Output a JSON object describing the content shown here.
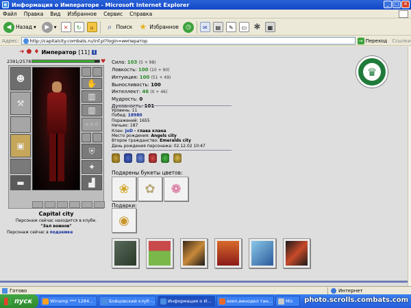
{
  "window": {
    "title": "Информация о Императоре - Microsoft Internet Explorer",
    "controls": [
      "_",
      "□",
      "✕"
    ]
  },
  "menu": [
    "Файл",
    "Правка",
    "Вид",
    "Избранное",
    "Сервис",
    "Справка"
  ],
  "toolbar": {
    "back": "Назад",
    "search": "Поиск",
    "favorites": "Избранное"
  },
  "address": {
    "label": "Адрес:",
    "url": "http://capitalcity.combats.ru/inf.pl?login=император",
    "go": "Переход",
    "links": "Ссылки"
  },
  "character": {
    "name": "Император",
    "level": "[11]",
    "hp": "2391/2578",
    "hp_fraction": 0.927,
    "city": "Capital city",
    "location_line1": "Персонаж сейчас находится в клубе.",
    "location_line2": "\"Зал воинов\"",
    "online_prefix": "Персонаж сейчас в",
    "online_link": "подземке"
  },
  "stats": [
    {
      "label": "Сила:",
      "value": "103",
      "bonus": "(5 + 98)",
      "green": true
    },
    {
      "label": "Ловкость:",
      "value": "100",
      "bonus": "(10 + 90)",
      "green": true
    },
    {
      "label": "Интуиция:",
      "value": "100",
      "bonus": "(51 + 49)",
      "green": true
    },
    {
      "label": "Выносливость:",
      "value": "100",
      "bonus": "",
      "green": false
    },
    {
      "label": "Интеллект:",
      "value": "46",
      "bonus": "(0 + 46)",
      "green": true
    },
    {
      "label": "Мудрость:",
      "value": "0",
      "bonus": "",
      "green": false
    },
    {
      "label": "Духовность:",
      "value": "101",
      "bonus": "",
      "green": false
    }
  ],
  "info": {
    "level": "Уровень: 11",
    "wins_label": "Побед:",
    "wins": "18980",
    "losses": "Поражений: 1655",
    "draws": "Ничьих: 187",
    "clan_label": "Клан:",
    "clan": "JoD",
    "clan_role": "- глава клана",
    "birthplace_label": "Место рождения:",
    "birthplace": "Angels city",
    "second_citizenship_label": "Второе гражданство:",
    "second_citizenship": "Emeralds city",
    "birthday": "День рождения персонажа: 02.12.02 10:47"
  },
  "sections": {
    "flowers": "Подарены букеты цветов:",
    "gifts": "Подарки:"
  },
  "statusbar": {
    "done": "Готово",
    "zone": "Интернет"
  },
  "taskbar": {
    "start": "пуск",
    "tasks": [
      "Winamp *** 1284...",
      "Бойцовский клуб -...",
      "Информация о И...",
      "exen,винодел тан...",
      "Mic"
    ],
    "watermark": "photo.scrolls.combats.com"
  },
  "colors": {
    "title_bar": "#1146c7",
    "stat_green": "#2a8a2a",
    "link_blue": "#0d2a9a",
    "clan_green": "#1f7a3a"
  }
}
